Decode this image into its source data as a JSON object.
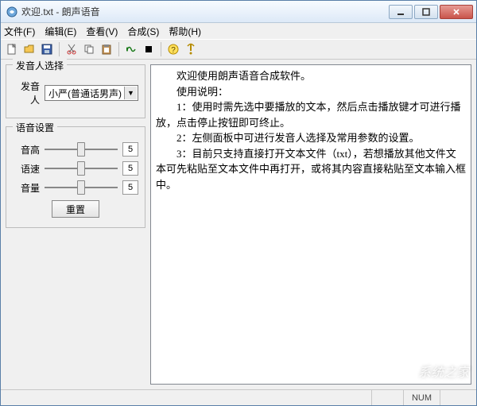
{
  "title": "欢迎.txt - 朗声语音",
  "menu": {
    "file": "文件(F)",
    "edit": "编辑(E)",
    "view": "查看(V)",
    "synth": "合成(S)",
    "help": "帮助(H)"
  },
  "group_voice": {
    "legend": "发音人选择",
    "label": "发音人",
    "value": "小严(普通话男声)"
  },
  "group_tts": {
    "legend": "语音设置",
    "pitch_label": "音高",
    "pitch_val": "5",
    "speed_label": "语速",
    "speed_val": "5",
    "volume_label": "音量",
    "volume_val": "5",
    "reset": "重置"
  },
  "text": {
    "l1": "　　欢迎使用朗声语音合成软件。",
    "l2": "　　使用说明：",
    "l3": "　　1：使用时需先选中要播放的文本，然后点击播放键才可进行播放，点击停止按钮即可终止。",
    "l4": "　　2：左侧面板中可进行发音人选择及常用参数的设置。",
    "l5": "　　3：目前只支持直接打开文本文件（txt），若想播放其他文件文本可先粘贴至文本文件中再打开，或将其内容直接粘贴至文本输入框中。"
  },
  "status": {
    "num": "NUM"
  },
  "watermark": "系统之家"
}
